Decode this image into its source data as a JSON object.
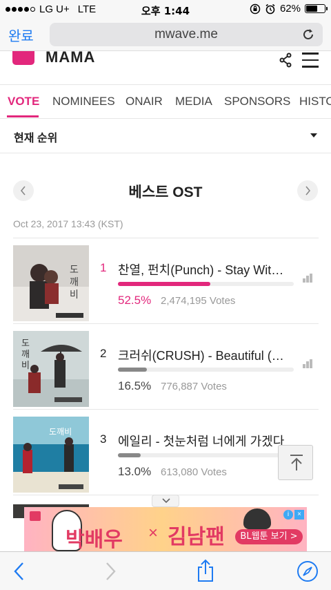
{
  "status_bar": {
    "carrier": "LG U+",
    "network": "LTE",
    "time": "오후 1:44",
    "battery_percent": "62%",
    "battery_level": 0.62
  },
  "browser": {
    "done_label": "완료",
    "url": "mwave.me"
  },
  "site": {
    "logo_text": "MAMA"
  },
  "tabs": [
    {
      "label": "VOTE",
      "active": true
    },
    {
      "label": "NOMINEES",
      "active": false
    },
    {
      "label": "ONAIR",
      "active": false
    },
    {
      "label": "MEDIA",
      "active": false
    },
    {
      "label": "SPONSORS",
      "active": false
    },
    {
      "label": "HISTO",
      "active": false
    }
  ],
  "dropdown": {
    "label": "현재 순위"
  },
  "category": {
    "title": "베스트 OST",
    "date": "Oct 23, 2017 13:43 (KST)"
  },
  "rankings": [
    {
      "rank": "1",
      "title": "찬열, 펀치(Punch) - Stay With Me",
      "percent": "52.5%",
      "share": 0.525,
      "votes": "2,474,195 Votes"
    },
    {
      "rank": "2",
      "title": "크러쉬(CRUSH) - Beautiful (Goblin OST)",
      "percent": "16.5%",
      "share": 0.165,
      "votes": "776,887 Votes"
    },
    {
      "rank": "3",
      "title": "에일리 - 첫눈처럼 너에게 가겠다",
      "percent": "13.0%",
      "share": 0.13,
      "votes": "613,080 Votes"
    }
  ],
  "ad": {
    "text_left": "박배우",
    "times": "×",
    "text_right": "김남팬",
    "cta": "BL웹툰 보기 >"
  },
  "colors": {
    "accent": "#e2277c",
    "ios_blue": "#1e7bf2"
  }
}
